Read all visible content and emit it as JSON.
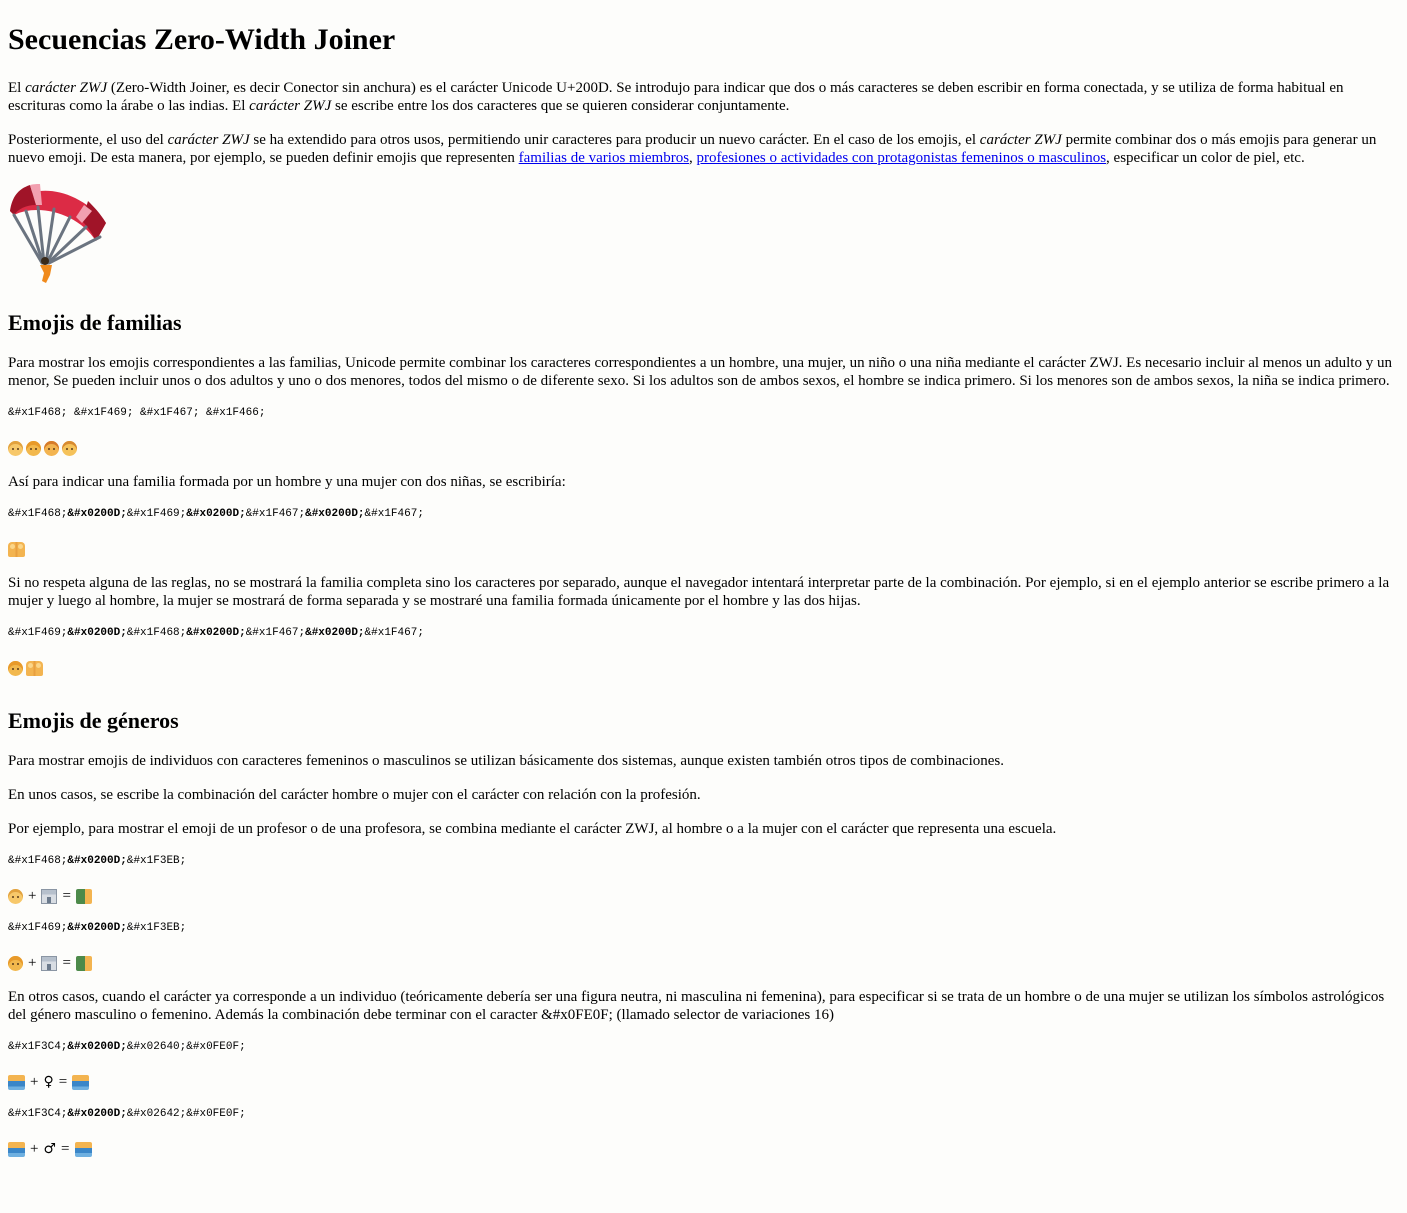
{
  "title": "Secuencias Zero-Width Joiner",
  "intro": {
    "p1": {
      "t1": "El ",
      "em1": "carácter ZWJ",
      "t2": " (Zero-Width Joiner, es decir Conector sin anchura) es el carácter Unicode U+200D. Se introdujo para indicar que dos o más caracteres se deben escribir en forma conectada, y se utiliza de forma habitual en escrituras como la árabe o las indias. El ",
      "em2": "carácter ZWJ",
      "t3": " se escribe entre los dos caracteres que se quieren considerar conjuntamente."
    },
    "p2": {
      "t1": "Posteriormente, el uso del ",
      "em1": "carácter ZWJ",
      "t2": " se ha extendido para otros usos, permitiendo unir caracteres para producir un nuevo carácter. En el caso de los emojis, el ",
      "em2": "carácter ZWJ",
      "t3": " permite combinar dos o más emojis para generar un nuevo emoji. De esta manera, por ejemplo, se pueden definir emojis que representen ",
      "link1": "familias de varios miembros",
      "t4": ", ",
      "link2": "profesiones o actividades con protagonistas femeninos o masculinos",
      "t5": ", especificar un color de piel, etc."
    }
  },
  "familias": {
    "heading": "Emojis de familias",
    "p1": "Para mostrar los emojis correspondientes a las familias, Unicode permite combinar los caracteres correspondientes a un hombre, una mujer, un niño o una niña mediante el carácter ZWJ. Es necesario incluir al menos un adulto y un menor, Se pueden incluir unos o dos adultos y uno o dos menores, todos del mismo o de diferente sexo. Si los adultos son de ambos sexos, el hombre se indica primero. Si los menores son de ambos sexos, la niña se indica primero.",
    "code1": "&#x1F468; &#x1F469; &#x1F467; &#x1F466;",
    "p2": "Así para indicar una familia formada por un hombre y una mujer con dos niñas, se escribiría:",
    "code2": [
      "&#x1F468;",
      "&#x0200D;",
      "&#x1F469;",
      "&#x0200D;",
      "&#x1F467;",
      "&#x0200D;",
      "&#x1F467;"
    ],
    "p3": "Si no respeta alguna de las reglas, no se mostrará la familia completa sino los caracteres por separado, aunque el navegador intentará interpretar parte de la combinación. Por ejemplo, si en el ejemplo anterior se escribe primero a la mujer y luego al hombre, la mujer se mostrará de forma separada y se mostraré una familia formada únicamente por el hombre y las dos hijas.",
    "code3": [
      "&#x1F469;",
      "&#x0200D;",
      "&#x1F468;",
      "&#x0200D;",
      "&#x1F467;",
      "&#x0200D;",
      "&#x1F467;"
    ]
  },
  "generos": {
    "heading": "Emojis de géneros",
    "p1": "Para mostrar emojis de individuos con caracteres femeninos o masculinos se utilizan básicamente dos sistemas, aunque existen también otros tipos de combinaciones.",
    "p2": "En unos casos, se escribe la combinación del carácter hombre o mujer con el carácter con relación con la profesión.",
    "p3": "Por ejemplo, para mostrar el emoji de un profesor o de una profesora, se combina mediante el carácter ZWJ, al hombre o a la mujer con el carácter que representa una escuela.",
    "code1": [
      "&#x1F468;",
      "&#x0200D;",
      "&#x1F3EB;"
    ],
    "code2": [
      "&#x1F469;",
      "&#x0200D;",
      "&#x1F3EB;"
    ],
    "p4": "En otros casos, cuando el carácter ya corresponde a un individuo (teóricamente debería ser una figura neutra, ni masculina ni femenina), para especificar si se trata de un hombre o de una mujer se utilizan los símbolos astrológicos del género masculino o femenino. Además la combinación debe terminar con el caracter &#x0FE0F; (llamado selector de variaciones 16)",
    "code3": [
      "&#x1F3C4;",
      "&#x0200D;",
      "&#x02640;",
      "&#x0FE0F;"
    ],
    "code4": [
      "&#x1F3C4;",
      "&#x0200D;",
      "&#x02642;",
      "&#x0FE0F;"
    ],
    "plus": "+",
    "equals": "=",
    "female_symbol": "♀",
    "male_symbol": "♂"
  },
  "icons": {
    "parachute": "parachute-icon",
    "man": "man-icon",
    "woman": "woman-icon",
    "girl": "girl-icon",
    "boy": "boy-icon",
    "family": "family-icon",
    "school": "school-icon",
    "teacher": "teacher-icon",
    "surfer": "surfer-icon"
  },
  "colors": {
    "link": "#0000ee",
    "background": "#fdfdfb",
    "parachute_red": "#dc2b45",
    "parachute_dark": "#a01428",
    "parachute_pink": "#f2a0b0"
  }
}
